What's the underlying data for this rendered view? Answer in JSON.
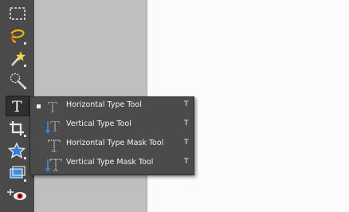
{
  "toolbar": {
    "tools": [
      {
        "name": "rectangular-marquee-icon"
      },
      {
        "name": "lasso-icon"
      },
      {
        "name": "magic-wand-icon"
      },
      {
        "name": "quick-selection-icon"
      },
      {
        "name": "type-icon",
        "active": true,
        "label": "T"
      },
      {
        "name": "crop-icon"
      },
      {
        "name": "custom-shape-icon"
      },
      {
        "name": "straighten-icon"
      },
      {
        "name": "red-eye-icon"
      }
    ]
  },
  "flyout": {
    "items": [
      {
        "label": "Horizontal Type Tool",
        "shortcut": "T",
        "selected": true,
        "icon": "horizontal-type-icon"
      },
      {
        "label": "Vertical Type Tool",
        "shortcut": "T",
        "selected": false,
        "icon": "vertical-type-icon"
      },
      {
        "label": "Horizontal Type Mask Tool",
        "shortcut": "T",
        "selected": false,
        "icon": "horizontal-type-mask-icon"
      },
      {
        "label": "Vertical Type Mask Tool",
        "shortcut": "T",
        "selected": false,
        "icon": "vertical-type-mask-icon"
      }
    ]
  },
  "colors": {
    "toolbar_bg": "#4a4a4a",
    "flyout_bg": "#4b4b4b",
    "canvas_gray": "#bfbfbf",
    "canvas_white": "#fbfbfb",
    "menu_text": "#f2f2f2",
    "accent_blue": "#3a8ee6"
  }
}
